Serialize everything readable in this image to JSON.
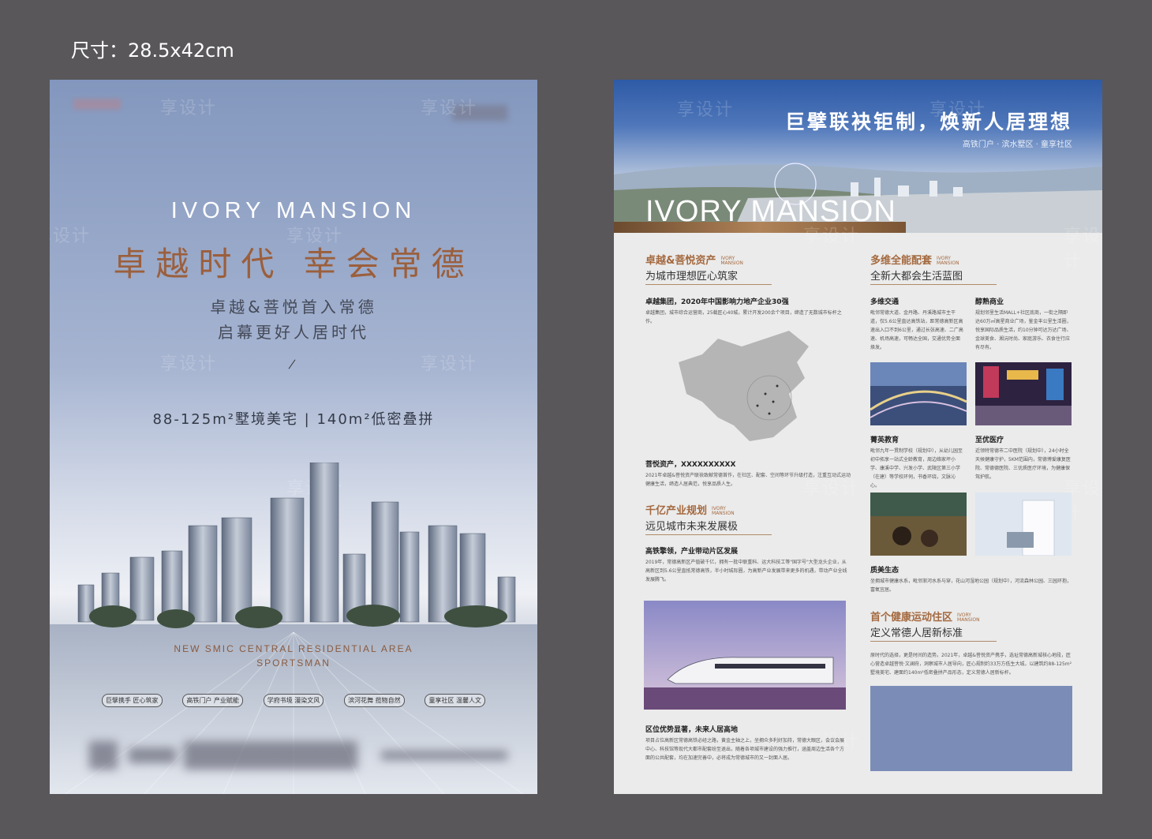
{
  "size_label": "尺寸：28.5x42cm",
  "watermark": "享设计",
  "left_poster": {
    "brand": "IVORY MANSION",
    "headline": "卓越时代  幸会常德",
    "subline1": "卓越&菩悦首入常德",
    "subline2": "启幕更好人居时代",
    "area_text": "88-125m²墅境美宅 | 140m²低密叠拼",
    "english_line1": "NEW SMIC CENTRAL RESIDENTIAL AREA",
    "english_line2": "SPORTSMAN",
    "tags": [
      "巨擘携手 匠心筑家",
      "高铁门户 产业赋能",
      "学府书境 漫染文风",
      "滨河花舞 揽物自然",
      "童享社区 温馨人文"
    ]
  },
  "right_poster": {
    "banner_title": "巨擘联袂钜制，焕新人居理想",
    "banner_tagline": "高铁门户 · 滨水墅区 · 童享社区",
    "banner_brand": "IVORY MANSION",
    "mini_logo": "IVORY MANSION",
    "sec1": {
      "title": "卓越&菩悦资产",
      "subtitle": "为城市理想匠心筑家",
      "h1": "卓越集团，2020年中国影响力地产企业30强",
      "p1": "卓越集团，城市综合运营商，25载匠心40城，累计开发200余个项目，缔造了无数城市标杆之作。",
      "h2": "菩悦资产，XXXXXXXXXX",
      "p2": "2021年卓越&菩悦资产联袂致献常德首作，在社区、配套、空间等环节升级打造，注重互动式运动健康生活，缔造人居典范，悦享品质人生。"
    },
    "sec2": {
      "title": "千亿产业规划",
      "subtitle": "远见城市未来发展极",
      "h1": "高铁擎领，产业带动片区发展",
      "p1": "2019年，常德高新区产值破千亿，拥有一批中联重科、运大科技工等\"国字号\"大型龙头企业，从高新区到5.6公里直抵常德高铁，半小时城际圈，为高新产业发展带来更多的机遇，带动产业全线发展腾飞。",
      "h2": "区位优势显著，未来人居高地",
      "p2": "项目占位高新区常德高铁必经之路，黄金主轴之上，坐拥众多利好加持，常德大眼区，会议会展中心、科技馆等现代大都市配套纷至退出，随着各项城市建设的强力推行，涵盖周边生活各个方面的公共配套，均在加速完善中，必将成为常德城市的又一封面人居。"
    },
    "sec3": {
      "title": "多维全能配套",
      "subtitle": "全新大都会生活蓝图",
      "h_transport": "多维交通",
      "p_transport": "毗邻常德大道、金丹路、丹溪路城市主干道，仅5.6公里直达高铁站，距常德高新区高速出入口不到6公里，通过长张高速、二广高速、机场高速，可畅达全国，交通优势全面焕发。",
      "h_commerce": "醇熟商业",
      "p_commerce": "规划邻里生活MALL+社区底商，一街之隔即达60万㎡高星商业广场，鉴金丰公里生活圈，悦享国际品质生活，约10分钟可达万达广场、金球美食、湘沅时尚、家庭游乐、衣食住行应有尽有。",
      "h_edu": "菁英教育",
      "p_edu": "毗邻九年一贯制学校（规划中），从幼儿园至初中拓享一站式全龄教育，周边络家坪小学、康溪中学、兴发小学、武陵区第三小学（在建）等学校环伺，书香环绕，文脉沁心。",
      "h_med": "至优医疗",
      "p_med": "近领特常德市二中医院（规划中），24小时全天候健康守护，5KM范围内，常德博爱康复医院、常德德医院、三优质医疗环境，为健康保驾护航。",
      "h_eco": "质美生态",
      "p_eco": "坐拥城市健康水系，毗邻渐河水系与穿，花山河湿地公园（规划中），河流森林公园、三园环抱，富氧宜居。"
    },
    "sec4": {
      "title": "首个健康运动住区",
      "subtitle": "定义常德人居新标准",
      "p1": "原时代的选择，更是时间的造势。2021年，卓越&菩悦资产携手，选址常德高新城核心地段，匠心营造卓越菩悦·文澜府，洞察城市人居导向，匠心规制约33万方低生大城，以建筑约88-125m²墅境美宅、建面约140m²低密叠拼产品形态，定义常德人居新标杆。"
    }
  }
}
